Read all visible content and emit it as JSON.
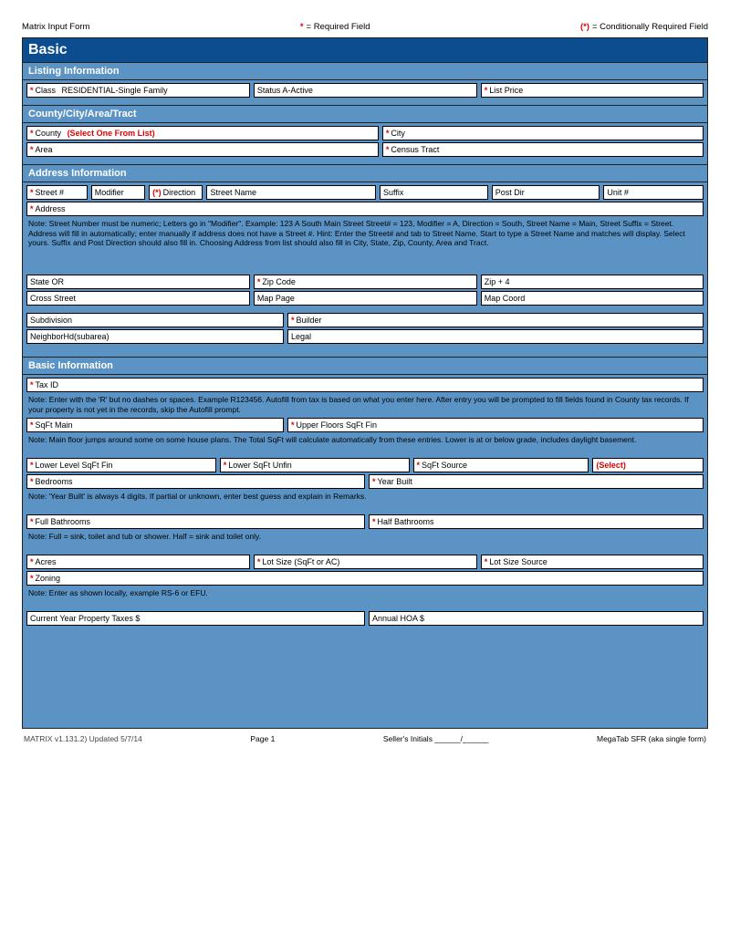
{
  "top": {
    "left_title": "Matrix Input Form",
    "req_star": "*",
    "req_label": "= Required Field",
    "cond_mark": "(*)",
    "cond_label": "= Conditionally Required Field"
  },
  "basic": {
    "title": "Basic",
    "listing_info_header": "Listing Information",
    "row1": {
      "a_label": "Class",
      "a_value": "RESIDENTIAL-Single Family",
      "b_label": "Status A-Active",
      "c_label": "List Price"
    },
    "county_header": "County/City/Area/Tract",
    "row2a": {
      "a_label": "County",
      "a_pick": "(Select One From List)",
      "b_label": "City"
    },
    "row2b": {
      "a_label": "Area",
      "b_label": "Census Tract"
    },
    "address_header": "Address Information",
    "row3a": {
      "a_label": "Street #",
      "b_label": "Modifier",
      "c_label": "Direction",
      "d_label": "Street Name",
      "e_label": "Suffix",
      "f_label": "Post Dir",
      "g_label": "Unit #"
    },
    "row3b": {
      "a_label": "Address"
    },
    "addr_note": "Note: Street Number must be numeric; Letters go in \"Modifier\". Example: 123 A South Main Street  Street# = 123, Modifier = A, Direction = South, Street Name = Main, Street Suffix = Street. Address will fill in automatically; enter manually if address does not have a Street #. Hint: Enter the Street# and tab to Street Name. Start to type a Street Name and matches will display. Select yours. Suffix and Post Direction should also fill in. Choosing Address from list should also fill in City, State, Zip, County, Area and Tract.",
    "row3c": {
      "a_label": "State OR",
      "b_label": "Zip Code",
      "c_label": "Zip + 4"
    },
    "row3d": {
      "a_label": "Cross Street",
      "b_label": "Map Page",
      "c_label": "Map Coord"
    },
    "row3e": {
      "a_label": "Subdivision",
      "b_label": "Builder"
    },
    "row3f": {
      "a_label": "NeighborHd(subarea)",
      "b_label": "Legal"
    },
    "basic_info_header": "Basic Information",
    "row4a": {
      "a_label": "Tax ID"
    },
    "tax_note": "Note: Enter with the 'R' but no dashes or spaces. Example R123456. Autofill from tax is based on what you enter here. After entry you will be prompted to fill fields found in County tax records. If your property is not yet in the records, skip the Autofill prompt.",
    "row4b": {
      "a_label": "SqFt Main",
      "b_label": "Upper Floors SqFt Fin"
    },
    "sqft_note": "Note: Main floor jumps around some on some house plans. The Total SqFt will calculate automatically from these entries. Lower is at or below grade, includes daylight basement.",
    "row4c": {
      "a_label": "Lower Level SqFt Fin",
      "b_label": "Lower SqFt Unfin",
      "c_label": "SqFt Source",
      "d_label": "(Select)"
    },
    "row4d": {
      "a_label": "Bedrooms",
      "b_label": "Year Built"
    },
    "yb_note": "Note: 'Year Built' is always 4 digits. If partial or unknown, enter best guess and explain in Remarks.",
    "row4e": {
      "a_label": "Full Bathrooms",
      "b_label": "Half Bathrooms"
    },
    "bath_note": "Note: Full = sink, toilet and tub or shower. Half = sink and toilet only.",
    "row4f": {
      "a_label": "Acres",
      "b_label": "Lot Size (SqFt or AC)",
      "c_label": "Lot Size Source"
    },
    "row4g": {
      "a_label": "Zoning"
    },
    "zone_note": "Note: Enter as shown locally, example RS-6 or EFU.",
    "row4h": {
      "a_label": "Current Year Property Taxes $",
      "b_label": "Annual HOA $"
    }
  },
  "footer": {
    "left": "MATRIX v1.131.2) Updated 5/7/14",
    "center": "Page 1",
    "right1": "Seller's Initials ______/______",
    "right2": "MegaTab SFR (aka single form)"
  }
}
